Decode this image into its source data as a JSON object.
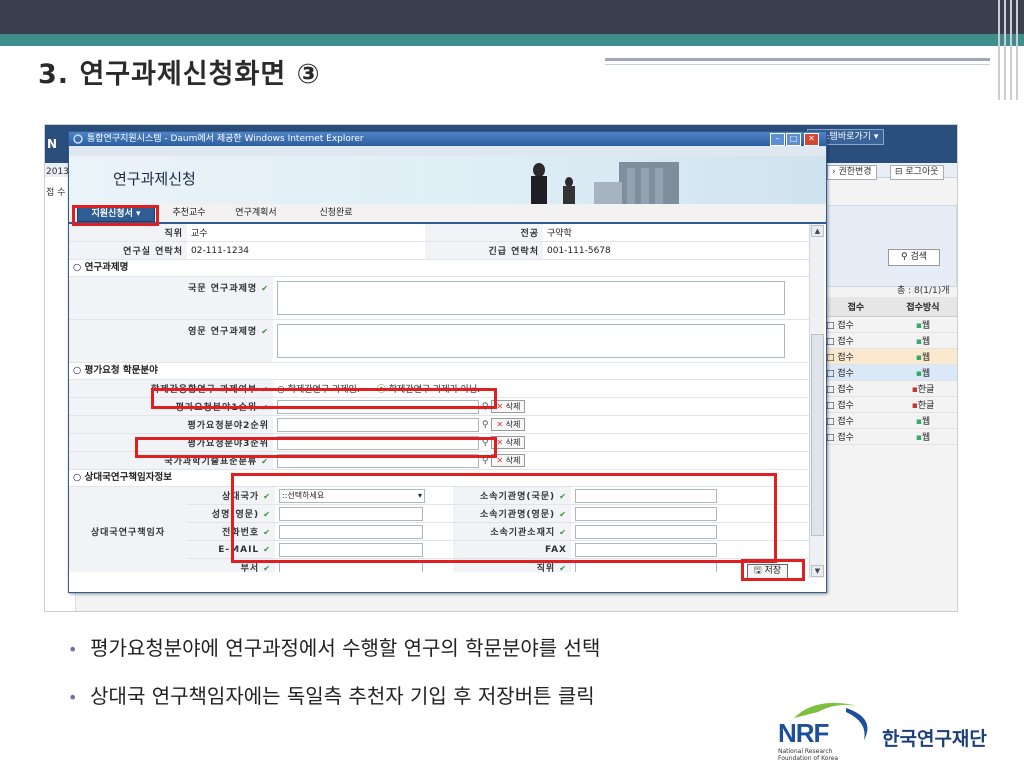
{
  "slide": {
    "title": "3. 연구과제신청화면 ③",
    "bullets": [
      "평가요청분야에 연구과정에서 수행할 연구의 학문분야를 선택",
      "상대국 연구책임자에는 독일측 추천자 기입 후 저장버튼 클릭"
    ]
  },
  "background_app": {
    "header_left_char": "N",
    "left_year": "2013",
    "left_label": "접 수",
    "system_shortcut": "시스템바로가기",
    "auth_change": "권한변경",
    "logout": "로그아웃",
    "search_button": "검색",
    "total": "총 : 8(1/1)개",
    "columns": [
      "접수",
      "접수방식"
    ],
    "rows": [
      {
        "status": "접수",
        "method": "웹"
      },
      {
        "status": "접수",
        "method": "웹"
      },
      {
        "status": "접수",
        "method": "웹"
      },
      {
        "status": "접수",
        "method": "웹"
      },
      {
        "status": "접수",
        "method": "한글"
      },
      {
        "status": "접수",
        "method": "한글"
      },
      {
        "status": "접수",
        "method": "웹"
      },
      {
        "status": "접수",
        "method": "웹"
      }
    ]
  },
  "window": {
    "title": "통합연구지원시스템 - Daum에서 제공한 Windows Internet Explorer",
    "banner_title": "연구과제신청",
    "tabs": [
      "지원신청서",
      "추천교수",
      "연구계획서",
      "신청완료"
    ],
    "info_rows": [
      {
        "label": "직위",
        "value": "교수",
        "label2": "전공",
        "value2": "구약학"
      },
      {
        "label": "연구실 연락처",
        "value": "02-111-1234",
        "label2": "긴급 연락처",
        "value2": "001-111-5678"
      }
    ],
    "sections": {
      "title_section": "연구과제명",
      "field_section": "평가요청 학문분야",
      "partner_section": "상대국연구책임자정보"
    },
    "title_fields": [
      "국문 연구과제명",
      "영문 연구과제명"
    ],
    "interdisciplinary": {
      "label": "학제간융합연구 과제여부",
      "option_yes": "학제간연구 과제임.",
      "option_no": "학제간연구 과제가 아님."
    },
    "field_rows": [
      "평가요청분야1순위",
      "평가요청분야2순위",
      "평가요청분야3순위",
      "국가과학기술표준분류"
    ],
    "delete_label": "삭제",
    "partner": {
      "group_label": "상대국연구책임자",
      "left_fields": [
        "상대국가",
        "성명(영문)",
        "전화번호",
        "E-MAIL",
        "부서"
      ],
      "country_select": "::선택하세요",
      "right_fields": [
        "소속기관명(국문)",
        "소속기관명(영문)",
        "소속기관소재지",
        "FAX",
        "직위"
      ]
    },
    "save_label": "저장"
  },
  "logo": {
    "text": "NRF",
    "org": "한국연구재단",
    "sub1": "National Research",
    "sub2": "Foundation of Korea"
  },
  "colors": {
    "header": "#3a3f4e",
    "teal": "#3f8e8c",
    "highlight": "#e02020",
    "logo_blue": "#1d4f9c",
    "logo_green": "#7fbf3f"
  }
}
